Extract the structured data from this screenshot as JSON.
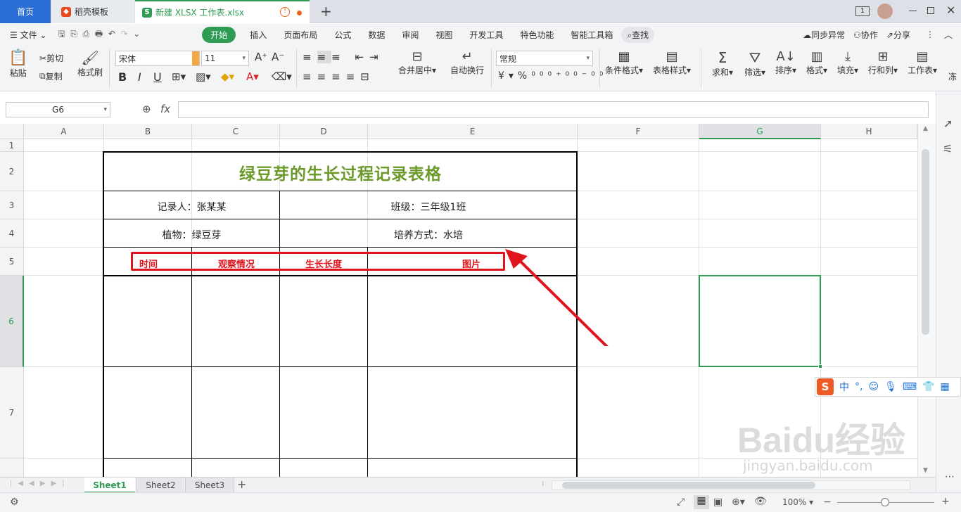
{
  "tabs": {
    "home": "首页",
    "docer": "稻壳模板",
    "file": "新建 XLSX 工作表.xlsx",
    "add": "+"
  },
  "titlebar": {
    "badge": "1"
  },
  "menu": {
    "file": "文件",
    "items": [
      "开始",
      "插入",
      "页面布局",
      "公式",
      "数据",
      "审阅",
      "视图",
      "开发工具",
      "特色功能",
      "智能工具箱"
    ],
    "search": "查找",
    "sync": "同步异常",
    "collab": "协作",
    "share": "分享"
  },
  "ribbon": {
    "paste": "粘贴",
    "cut": "剪切",
    "copy": "复制",
    "format_painter": "格式刷",
    "font_name": "宋体",
    "font_size": "11",
    "merge": "合并居中",
    "wrap": "自动换行",
    "number_format": "常规",
    "cond_format": "条件格式",
    "table_style": "表格样式",
    "sum": "求和",
    "filter": "筛选",
    "sort": "排序",
    "format": "格式",
    "fill": "填充",
    "rowcol": "行和列",
    "sheet": "工作表",
    "more": "冻"
  },
  "formula_bar": {
    "cell_ref": "G6",
    "fx": "fx",
    "content": ""
  },
  "columns": [
    "A",
    "B",
    "C",
    "D",
    "E",
    "F",
    "G",
    "H"
  ],
  "rows": [
    "1",
    "2",
    "3",
    "4",
    "5",
    "6",
    "7"
  ],
  "sheet": {
    "title": "绿豆芽的生长过程记录表格",
    "recorder": "记录人：张某某",
    "class": "班级：三年级1班",
    "plant": "植物：绿豆芽",
    "method": "培养方式：水培",
    "headers": [
      "时间",
      "观察情况",
      "生长长度",
      "图片"
    ]
  },
  "sheets": [
    "Sheet1",
    "Sheet2",
    "Sheet3"
  ],
  "status": {
    "zoom": "100%"
  },
  "ime": {
    "zh": "中",
    "punct": "°,"
  },
  "watermark": {
    "text1": "Baidu经验",
    "text2": "jingyan.baidu.com"
  },
  "colors": {
    "accent": "#2e9c52",
    "title_green": "#6b9a2a",
    "red": "#e0141c",
    "home_tab": "#2b6fd6"
  }
}
